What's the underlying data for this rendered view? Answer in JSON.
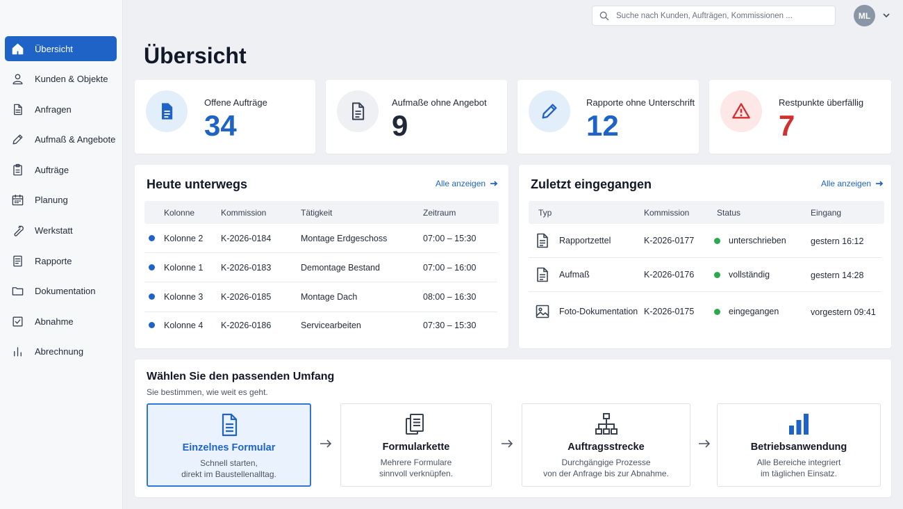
{
  "sidebar": {
    "items": [
      {
        "label": "Übersicht",
        "icon": "home-icon",
        "active": true
      },
      {
        "label": "Kunden & Objekte",
        "icon": "user-icon"
      },
      {
        "label": "Anfragen",
        "icon": "document-icon"
      },
      {
        "label": "Aufmaß & Angebote",
        "icon": "pencil-icon"
      },
      {
        "label": "Aufträge",
        "icon": "clipboard-icon"
      },
      {
        "label": "Planung",
        "icon": "calendar-icon"
      },
      {
        "label": "Werkstatt",
        "icon": "wrench-icon"
      },
      {
        "label": "Rapporte",
        "icon": "report-icon"
      },
      {
        "label": "Dokumentation",
        "icon": "folder-icon"
      },
      {
        "label": "Abnahme",
        "icon": "checkbox-icon"
      },
      {
        "label": "Abrechnung",
        "icon": "bar-chart-icon"
      }
    ]
  },
  "header": {
    "search_placeholder": "Suche nach Kunden, Aufträgen, Kommissionen ...",
    "avatar_initials": "ML"
  },
  "page_title": "Übersicht",
  "kpis": [
    {
      "label": "Offene Aufträge",
      "value": "34",
      "color": "#1f63c6",
      "bg": "#e3eefb",
      "icon": "document-icon"
    },
    {
      "label": "Aufmaße ohne Angebot",
      "value": "9",
      "color": "#1f2937",
      "bg": "#eef0f3",
      "icon": "document-icon"
    },
    {
      "label": "Rapporte ohne Unterschrift",
      "value": "12",
      "color": "#1f63c6",
      "bg": "#e3eefb",
      "icon": "pencil-icon"
    },
    {
      "label": "Restpunkte überfällig",
      "value": "7",
      "color": "#d32f2f",
      "bg": "#fde7e7",
      "icon": "warning-icon"
    }
  ],
  "today": {
    "title": "Heute unterwegs",
    "link": "Alle anzeigen",
    "columns": [
      "Kolonne",
      "Kommission",
      "Tätigkeit",
      "Zeitraum"
    ],
    "rows": [
      {
        "kolonne": "Kolonne 2",
        "kommission": "K-2026-0184",
        "taetigkeit": "Montage Erdgeschoss",
        "zeitraum": "07:00 – 15:30"
      },
      {
        "kolonne": "Kolonne 1",
        "kommission": "K-2026-0183",
        "taetigkeit": "Demontage Bestand",
        "zeitraum": "07:00 – 16:00"
      },
      {
        "kolonne": "Kolonne 3",
        "kommission": "K-2026-0185",
        "taetigkeit": "Montage Dach",
        "zeitraum": "08:00 – 16:30"
      },
      {
        "kolonne": "Kolonne 4",
        "kommission": "K-2026-0186",
        "taetigkeit": "Servicearbeiten",
        "zeitraum": "07:30 – 15:30"
      }
    ],
    "dot_color": "#1f63c6"
  },
  "recent": {
    "title": "Zuletzt eingegangen",
    "link": "Alle anzeigen",
    "columns": [
      "Typ",
      "Kommission",
      "Status",
      "Eingang"
    ],
    "rows": [
      {
        "typ": "Rapportzettel",
        "icon": "document-icon",
        "kommission": "K-2026-0177",
        "status": "unterschrieben",
        "eingang": "gestern 16:12"
      },
      {
        "typ": "Aufmaß",
        "icon": "document-icon",
        "kommission": "K-2026-0176",
        "status": "vollständig",
        "eingang": "gestern 14:28"
      },
      {
        "typ": "Foto-Dokumentation",
        "icon": "image-icon",
        "kommission": "K-2026-0175",
        "status": "eingegangen",
        "eingang": "vorgestern 09:41"
      }
    ],
    "status_color": "#2ea84f"
  },
  "scope": {
    "title": "Wählen Sie den passenden Umfang",
    "subtitle": "Sie bestimmen, wie weit es geht.",
    "options": [
      {
        "title": "Einzelnes Formular",
        "desc1": "Schnell starten,",
        "desc2": "direkt im Baustellenalltag.",
        "icon": "form-icon",
        "selected": true
      },
      {
        "title": "Formularkette",
        "desc1": "Mehrere Formulare",
        "desc2": "sinnvoll verknüpfen.",
        "icon": "stacked-documents-icon"
      },
      {
        "title": "Auftragsstrecke",
        "desc1": "Durchgängige Prozesse",
        "desc2": "von der Anfrage bis zur Abnahme.",
        "icon": "hierarchy-icon"
      },
      {
        "title": "Betriebsanwendung",
        "desc1": "Alle Bereiche integriert",
        "desc2": "im täglichen Einsatz.",
        "icon": "bar-chart-icon"
      }
    ]
  }
}
